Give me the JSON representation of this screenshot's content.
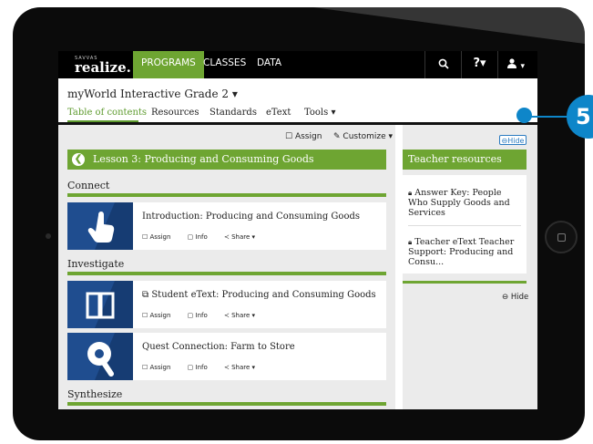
{
  "topnav": {
    "brand_small": "SAVVAS",
    "brand": "realize.",
    "items": [
      "PROGRAMS",
      "CLASSES",
      "DATA"
    ],
    "search_icon": "search-icon",
    "help_label": "?▾",
    "user_label": "▾"
  },
  "program_title": "myWorld Interactive Grade 2 ▾",
  "tabs": [
    "Table of contents",
    "Resources",
    "Standards",
    "eText",
    "Tools ▾"
  ],
  "toolbar": {
    "assign": "Assign",
    "customize": "Customize ▾"
  },
  "lesson": {
    "back_icon": "back-arrow-icon",
    "title": "Lesson 3: Producing and Consuming Goods"
  },
  "sections": [
    "Connect",
    "Investigate",
    "Synthesize"
  ],
  "cards": [
    {
      "title": "Introduction: Producing and Consuming Goods",
      "icon": "hand-pointer-icon",
      "assign": "Assign",
      "info": "Info",
      "share": "Share ▾"
    },
    {
      "title": "Student eText: Producing and Consuming Goods",
      "icon": "book-icon",
      "assign": "Assign",
      "info": "Info",
      "share": "Share ▾"
    },
    {
      "title": "Quest Connection: Farm to Store",
      "icon": "quest-magnifier-icon",
      "assign": "Assign",
      "info": "Info",
      "share": "Share ▾"
    }
  ],
  "teacher": {
    "heading": "Teacher resources",
    "hide_label": "Hide",
    "items": [
      "Answer Key: People Who Supply Goods and Services",
      "Teacher eText Teacher Support: Producing and Consu..."
    ],
    "hide_bottom": "Hide"
  },
  "callout": {
    "number": "5"
  },
  "colors": {
    "accent_green": "#6ea532",
    "callout_blue": "#0e86c9",
    "thumb_blue": "#1f4d8f"
  }
}
